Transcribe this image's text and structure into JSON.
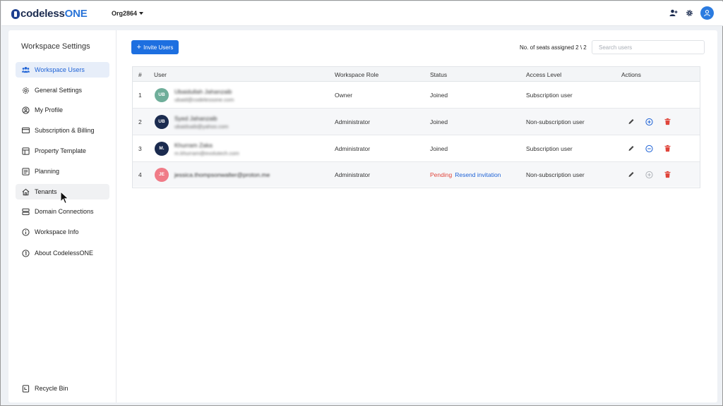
{
  "header": {
    "logo_text_1": "codeless",
    "logo_text_2": "ONE",
    "org_name": "Org2864",
    "icons": [
      "add-user-icon",
      "gear-icon",
      "user-avatar-icon"
    ]
  },
  "sidebar": {
    "title": "Workspace Settings",
    "items": [
      {
        "label": "Workspace Users",
        "icon": "users-icon"
      },
      {
        "label": "General Settings",
        "icon": "gear-icon"
      },
      {
        "label": "My Profile",
        "icon": "profile-icon"
      },
      {
        "label": "Subscription & Billing",
        "icon": "card-icon"
      },
      {
        "label": "Property Template",
        "icon": "template-icon"
      },
      {
        "label": "Planning",
        "icon": "planning-icon"
      },
      {
        "label": "Tenants",
        "icon": "home-icon"
      },
      {
        "label": "Domain Connections",
        "icon": "server-icon"
      },
      {
        "label": "Workspace Info",
        "icon": "info-icon"
      },
      {
        "label": "About CodelessONE",
        "icon": "about-icon"
      }
    ],
    "recycle_bin": "Recycle Bin"
  },
  "toolbar": {
    "invite_label": "Invite Users",
    "seats_text": "No. of seats assigned 2 \\ 2",
    "search_placeholder": "Search users"
  },
  "table": {
    "columns": [
      "#",
      "User",
      "Workspace Role",
      "Status",
      "Access Level",
      "Actions"
    ],
    "rows": [
      {
        "num": "1",
        "initials": "UB",
        "avatar_color": "#6fae9a",
        "name": "Ubaidullah Jahanzaib",
        "email": "ubaid@codelessone.com",
        "role": "Owner",
        "status": "Joined",
        "access": "Subscription user",
        "actions": []
      },
      {
        "num": "2",
        "initials": "UB",
        "avatar_color": "#1b2b4f",
        "name": "Syed Jahanzaib",
        "email": "ubaidsaib@yahoo.com",
        "role": "Administrator",
        "status": "Joined",
        "access": "Non-subscription user",
        "actions": [
          "edit",
          "plus",
          "delete"
        ]
      },
      {
        "num": "3",
        "initials": "M.",
        "avatar_color": "#1b2b4f",
        "name": "Khurram Zaka",
        "email": "m.khurram@evolutech.com",
        "role": "Administrator",
        "status": "Joined",
        "access": "Subscription user",
        "actions": [
          "edit",
          "minus",
          "delete"
        ]
      },
      {
        "num": "4",
        "initials": "JE",
        "avatar_color": "#f07b87",
        "name": "",
        "email": "jessica.thompsonwalter@proton.me",
        "role": "Administrator",
        "status": "Pending",
        "resend": "Resend invitation",
        "access": "Non-subscription user",
        "actions": [
          "edit",
          "plus-disabled",
          "delete"
        ]
      }
    ]
  },
  "colors": {
    "accent": "#1d6fe0",
    "pending": "#e0453b",
    "delete": "#e0453b",
    "active_bg": "#e7eef9"
  }
}
